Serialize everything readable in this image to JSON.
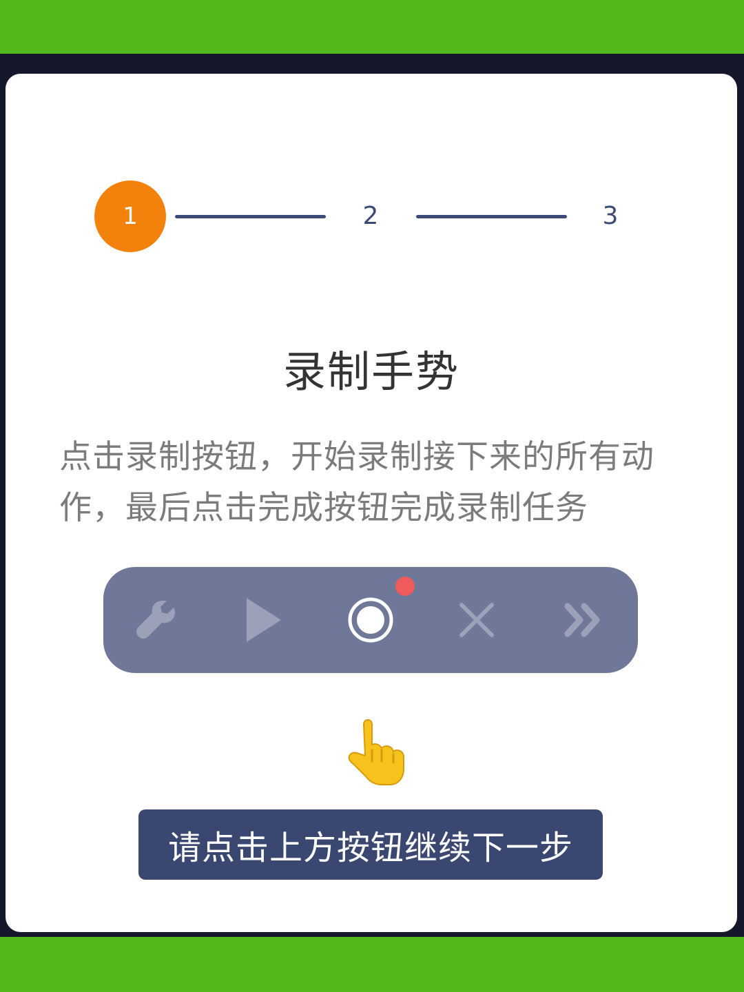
{
  "stepper": {
    "steps": [
      {
        "label": "1",
        "active": true
      },
      {
        "label": "2",
        "active": false
      },
      {
        "label": "3",
        "active": false
      }
    ]
  },
  "title": "录制手势",
  "description": "点击录制按钮，开始录制接下来的所有动作，最后点击完成按钮完成录制任务",
  "toolbar": {
    "buttons": [
      {
        "icon": "wrench-icon"
      },
      {
        "icon": "play-icon"
      },
      {
        "icon": "record-icon",
        "recording_indicator": true
      },
      {
        "icon": "close-icon"
      },
      {
        "icon": "fast-forward-icon"
      }
    ]
  },
  "pointer": {
    "icon": "pointing-hand-icon"
  },
  "hint_button": {
    "label": "请点击上方按钮继续下一步"
  },
  "colors": {
    "background": "#52b81c",
    "accent": "#f2820b",
    "primary": "#3a4770",
    "toolbar": "#6f7898",
    "recording_dot": "#ef5a5a"
  }
}
